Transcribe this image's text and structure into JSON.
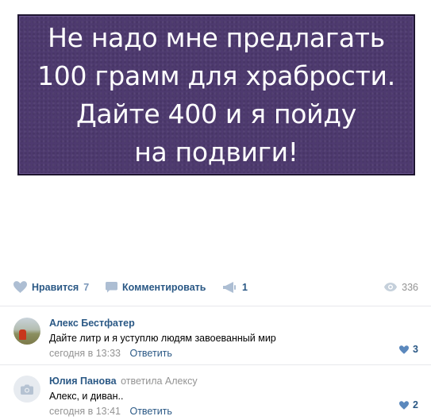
{
  "meme": {
    "lines": [
      "Не надо мне предлагать",
      "100 грамм для храбрости.",
      "Дайте 400 и я пойду",
      "на подвиги!"
    ]
  },
  "actions": {
    "like_label": "Нравится",
    "like_count": "7",
    "comment_label": "Комментировать",
    "share_count": "1",
    "views_count": "336"
  },
  "comments": [
    {
      "author": "Алекс Бестфатер",
      "replied_to": "",
      "text": "Дайте литр и я уступлю людям завоеванный мир",
      "time": "сегодня в 13:33",
      "reply_label": "Ответить",
      "likes": "3"
    },
    {
      "author": "Юлия Панова",
      "replied_to": "ответила Алексу",
      "text": "Алекс, и диван..",
      "time": "сегодня в 13:41",
      "reply_label": "Ответить",
      "likes": "2"
    }
  ],
  "colors": {
    "link": "#2a5885",
    "muted": "#939393",
    "meme_bg": "#4e3a6f"
  }
}
